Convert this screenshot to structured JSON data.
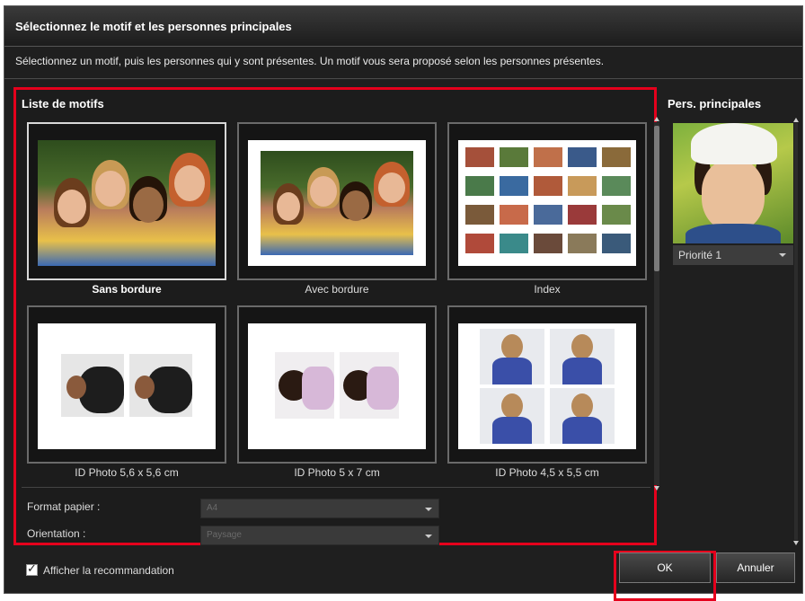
{
  "dialog": {
    "title": "Sélectionnez le motif et les personnes principales",
    "instruction": "Sélectionnez un motif, puis les personnes qui y sont présentes. Un motif vous sera proposé selon les personnes présentes."
  },
  "motifs": {
    "title": "Liste de motifs",
    "items": [
      {
        "label": "Sans bordure",
        "selected": true
      },
      {
        "label": "Avec bordure",
        "selected": false
      },
      {
        "label": "Index",
        "selected": false
      },
      {
        "label": "ID Photo 5,6 x 5,6 cm",
        "selected": false
      },
      {
        "label": "ID Photo 5 x 7 cm",
        "selected": false
      },
      {
        "label": "ID Photo 4,5 x 5,5 cm",
        "selected": false
      }
    ]
  },
  "form": {
    "paper_label": "Format papier :",
    "paper_value": "A4",
    "orientation_label": "Orientation :",
    "orientation_value": "Paysage"
  },
  "persons": {
    "title": "Pers. principales",
    "priority_value": "Priorité 1"
  },
  "footer": {
    "recommend_label": "Afficher la recommandation",
    "recommend_checked": true,
    "ok_label": "OK",
    "cancel_label": "Annuler"
  },
  "colors": {
    "highlight": "#e5001c",
    "background": "#1f1f1f"
  }
}
